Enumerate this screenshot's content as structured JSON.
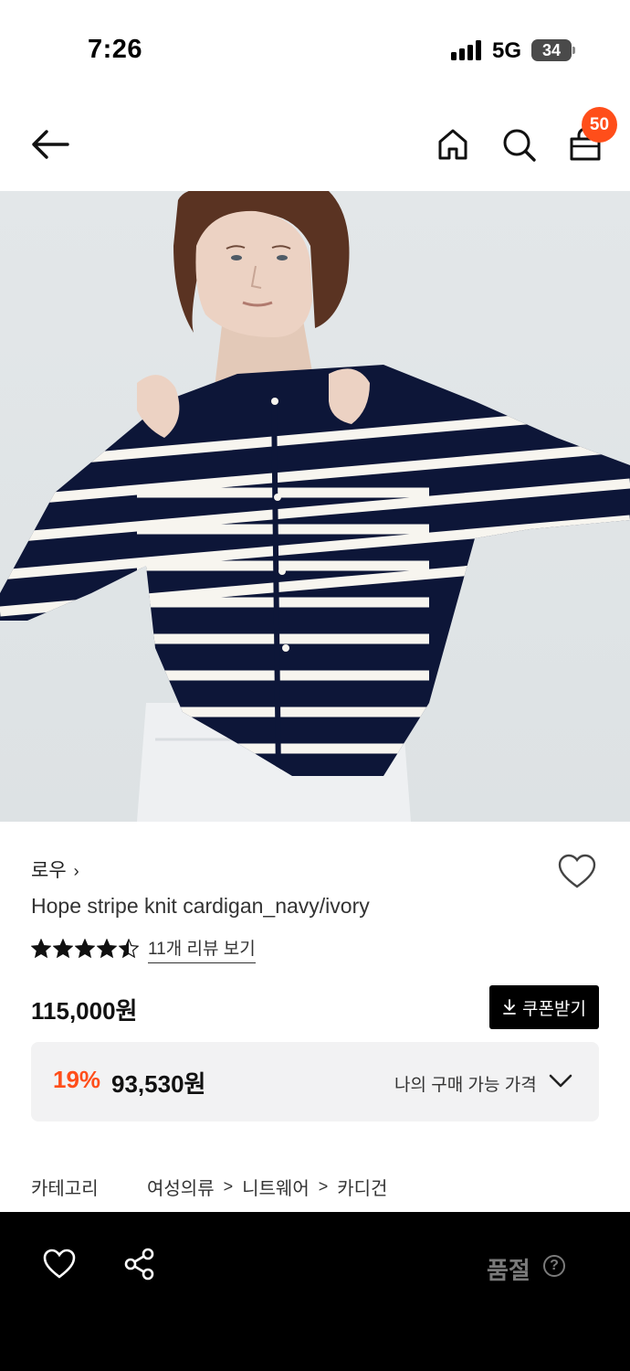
{
  "status_bar": {
    "time": "7:26",
    "network": "5G",
    "battery": "34"
  },
  "header": {
    "cart_count": "50",
    "icons": [
      "back-arrow-icon",
      "home-icon",
      "search-icon",
      "shopping-bag-icon"
    ]
  },
  "product": {
    "image_icon": "product-photo",
    "brand": "로우",
    "brand_chevron": "›",
    "title": "Hope stripe knit cardigan_navy/ivory",
    "rating": 4.5,
    "rating_max": 5,
    "review_link": "11개 리뷰 보기",
    "price": "115,000원",
    "coupon_button": "쿠폰받기",
    "discount": "19%",
    "sale_price": "93,530원",
    "best_price_label": "나의 구매 가능 가격",
    "category": {
      "label": "카테고리",
      "path": [
        "여성의류",
        "니트웨어",
        "카디건"
      ],
      "separator": ">"
    }
  },
  "bottom_bar": {
    "sold_out": "품절",
    "help": "?",
    "icons": [
      "heart-icon",
      "share-icon"
    ]
  },
  "colors": {
    "accent": "#ff4e1a",
    "navy": "#0d1638",
    "ivory": "#f7f5ef",
    "bottom_bar": "#000000",
    "muted": "#7a7a7a"
  }
}
